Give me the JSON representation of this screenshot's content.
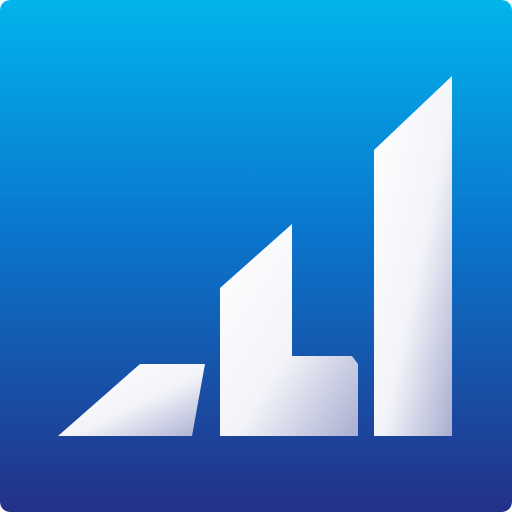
{
  "icon": {
    "name": "signal-strength-bars-icon",
    "colors": {
      "background_top": "#02b4ec",
      "background_mid": "#0a76cd",
      "background_bottom": "#233187",
      "bars_light": "#ffffff",
      "bars_shade": "#a9aed0"
    }
  }
}
